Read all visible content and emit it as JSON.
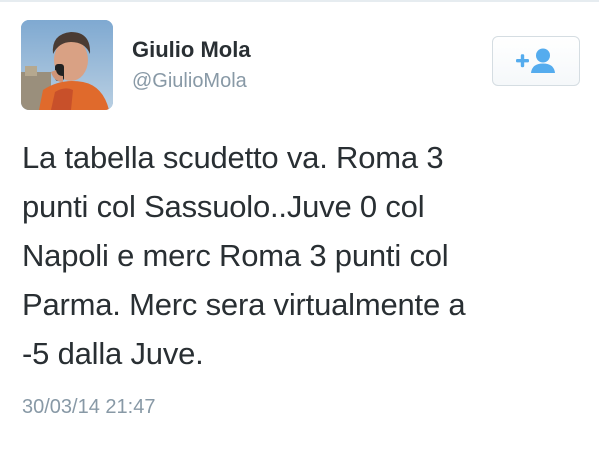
{
  "user": {
    "display_name": "Giulio Mola",
    "handle": "@GiulioMola",
    "avatar_icon": "profile-photo"
  },
  "follow_button": {
    "icon": "follow-user-icon",
    "accent_color": "#55acee"
  },
  "tweet": {
    "lines": [
      "La tabella scudetto va. Roma 3",
      "punti col Sassuolo..Juve 0 col",
      "Napoli e merc Roma 3 punti col",
      "Parma. Merc sera virtualmente a",
      "-5 dalla Juve."
    ],
    "timestamp": "30/03/14 21:47"
  }
}
